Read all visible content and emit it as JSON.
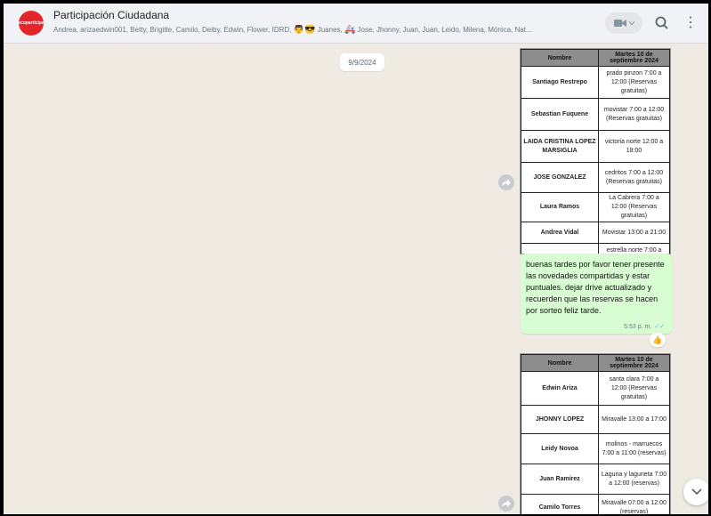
{
  "header": {
    "avatar_text": "ecoparticipa",
    "title": "Participación Ciudadana",
    "members_part1": "Andrea, arizaedwin001, Betty, Brigitte, Camilo, Deiby, Edwin, Flower, IDRD, ",
    "emoji1": "👨😎",
    "members_part2": " Juanes, ",
    "emoji2": "🚑",
    "members_part3": " Jose, Jhonny, Juan, Juan, Leido, Milena, Mónica, Nat..."
  },
  "date_chip": "9/9/2024",
  "table1": {
    "header_name": "Nombre",
    "header_date": "Martes 10 de septiembre 2024",
    "rows": [
      {
        "name": "Santiago Restrepo",
        "detail": "prado pinzon 7:00 a 12:00 (Reservas gratuitas)"
      },
      {
        "name": "Sebastian Fuquene",
        "detail": "movistar 7:00 a 12:00 (Reservas gratuitas)"
      },
      {
        "name": "LAIDA CRISTINA LOPEZ MARSIGLIA",
        "detail": "victoria norte 12:00 a 18:00"
      },
      {
        "name": "JOSE GONZALEZ",
        "detail": "cedritos 7:00 a 12:00 (Reservas gratuitas)"
      },
      {
        "name": "Laura Ramos",
        "detail": "La Cabrera 7:00 a 12:00 (Reservas gratuitas)"
      },
      {
        "name": "Andrea Vidal",
        "detail": "Movistar 13:00 a 21:00"
      },
      {
        "name": "",
        "detail": "estrella norte 7:00 a"
      }
    ]
  },
  "message": {
    "text": "buenas tardes por favor tener presente las novedades compartidas y estar puntuales. dejar drive actualizado y recuerden que las reservas se hacen por sorteo feliz tarde.",
    "time": "5:53 p. m.",
    "ticks": "✓✓",
    "reaction": "👍"
  },
  "table2": {
    "header_name": "Nombre",
    "header_date": "Martes 10 de septiembre 2024",
    "rows": [
      {
        "name": "Edwin Ariza",
        "detail": "santa clara 7:00 a 12:00 (Reservas gratuitas)"
      },
      {
        "name": "JHONNY LOPEZ",
        "detail": "Miravalle 13:00 a 17:00"
      },
      {
        "name": "Leidy Novoa",
        "detail": "molinos - marruecos 7:00 a 11:00 (reservas)"
      },
      {
        "name": "Juan Ramirez",
        "detail": "Laguna y laguneta 7:00 a 12:00 (reservas)"
      },
      {
        "name": "Camilo Torres",
        "detail": "Miravalle 07:00 a 12:00 (reservas)"
      }
    ]
  },
  "icons": {
    "video": "video-call-icon",
    "search": "search-icon",
    "menu": "more-options-icon",
    "forward": "forward-icon",
    "scroll": "chevron-down-icon"
  },
  "colors": {
    "brand_red": "#e3262b",
    "outgoing_bubble": "#d9fdd3",
    "chat_bg": "#efeae2",
    "read_ticks": "#53bdeb"
  }
}
